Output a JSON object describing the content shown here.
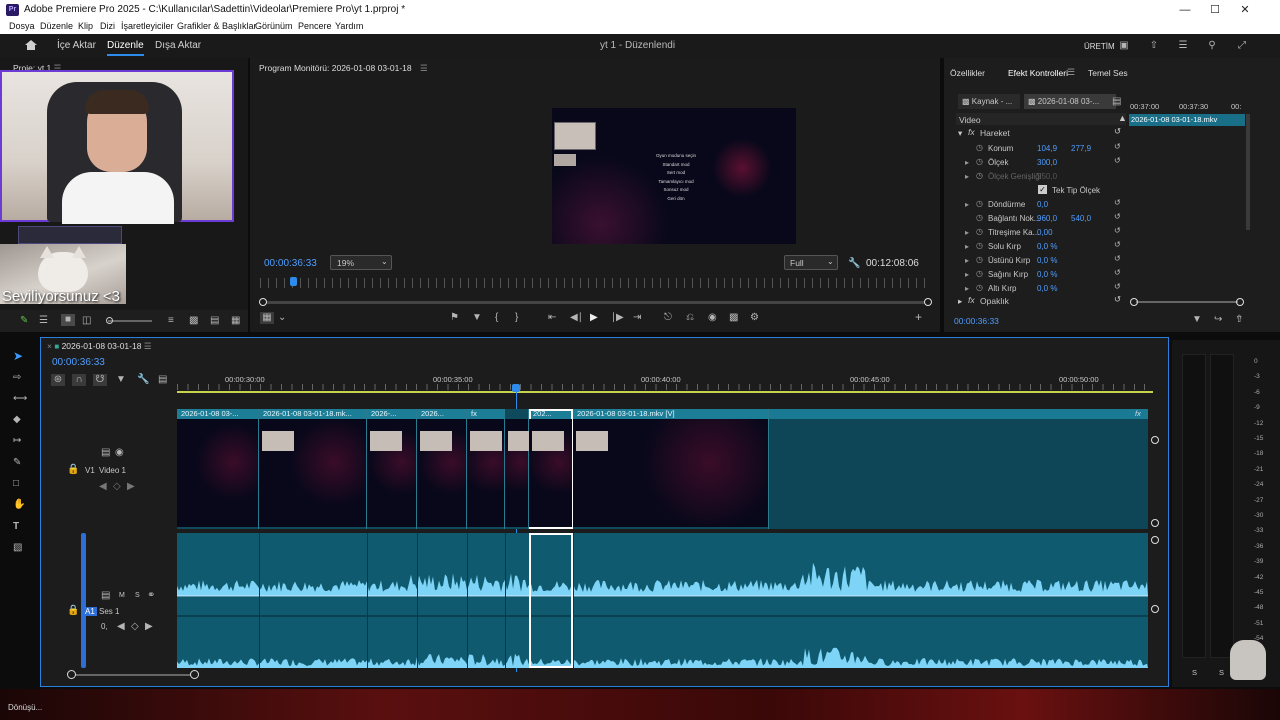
{
  "window": {
    "title": "Adobe Premiere Pro 2025 - C:\\Kullanıcılar\\Sadettin\\Videolar\\Premiere Pro\\yt 1.prproj *",
    "logo": "Pr"
  },
  "menu": [
    "Dosya",
    "Düzenle",
    "Klip",
    "Dizi",
    "İşaretleyiciler",
    "Grafikler & Başlıklar",
    "Görünüm",
    "Pencere",
    "Yardım"
  ],
  "nav": {
    "home_icon": "home-icon",
    "import": "İçe Aktar",
    "edit": "Düzenle",
    "export": "Dışa Aktar",
    "center_title": "yt 1 - Düzenlendi",
    "workspace": "ÜRETİM"
  },
  "project": {
    "title": "Proje: yt 1",
    "webcam_caption": "Seviliyorsunuz <3"
  },
  "program_monitor": {
    "title": "Program Monitörü: 2026-01-08 03-01-18",
    "timecode": "00:00:36:33",
    "zoom": "19%",
    "quality": "Full",
    "duration": "00:12:08:06",
    "preview_menu": [
      "Oyun modunu seçin",
      "Standart mod",
      "Sert mod",
      "Tamamlayıcı mod",
      "Sonsuz mod",
      "Geri dön"
    ]
  },
  "effect_panel": {
    "tabs": [
      "Özellikler",
      "Efekt Kontrolleri",
      "Temel Ses"
    ],
    "source_label": "Kaynak - ...",
    "clip_label": "2026-01-08 03-...",
    "mini_times": [
      "00:37:00",
      "00:37:30",
      "00:"
    ],
    "mini_clip": "2026-01-08 03-01-18.mkv",
    "section_video": "Video",
    "fx_motion": "Hareket",
    "props": [
      {
        "name": "Konum",
        "v1": "104,9",
        "v2": "277,9"
      },
      {
        "name": "Ölçek",
        "v1": "300,0",
        "v2": ""
      },
      {
        "name": "Ölçek Genişliği",
        "v1": "250,0",
        "v2": ""
      },
      {
        "name": "Tek Tip Ölçek",
        "v1": "",
        "v2": ""
      },
      {
        "name": "Döndürme",
        "v1": "0,0",
        "v2": ""
      },
      {
        "name": "Bağlantı Nok...",
        "v1": "960,0",
        "v2": "540,0"
      },
      {
        "name": "Titreşime Ka...",
        "v1": "0,00",
        "v2": ""
      },
      {
        "name": "Solu Kırp",
        "v1": "0,0 %",
        "v2": ""
      },
      {
        "name": "Üstünü Kırp",
        "v1": "0,0 %",
        "v2": ""
      },
      {
        "name": "Sağını Kırp",
        "v1": "0,0 %",
        "v2": ""
      },
      {
        "name": "Altı Kırp",
        "v1": "0,0 %",
        "v2": ""
      }
    ],
    "fx_opacity": "Opaklık",
    "timecode": "00:00:36:33"
  },
  "timeline": {
    "sequence_name": "2026-01-08 03-01-18",
    "timecode": "00:00:36:33",
    "ruler": [
      "00:00:30:00",
      "00:00:35:00",
      "00:00:40:00",
      "00:00:45:00",
      "00:00:50:00"
    ],
    "v1_label": "V1",
    "v1_name": "Video 1",
    "a1_label": "A1",
    "a1_name": "Ses 1",
    "a1_volume": "0,",
    "track_letters": [
      "M",
      "S"
    ],
    "fx_marker": "fx",
    "clips": [
      {
        "label": "2026-01-08 03-..."
      },
      {
        "label": "2026-01-08 03-01-18.mk..."
      },
      {
        "label": "2026-..."
      },
      {
        "label": "2026..."
      },
      {
        "label": "fx"
      },
      {
        "label": ""
      },
      {
        "label": "202..."
      },
      {
        "label": "2026-01-08 03-01-18.mkv [V]"
      }
    ]
  },
  "meter": {
    "scale": [
      "0",
      "-3",
      "-6",
      "-9",
      "-12",
      "-15",
      "-18",
      "-21",
      "-24",
      "-27",
      "-30",
      "-33",
      "-36",
      "-39",
      "-42",
      "-45",
      "-48",
      "-51",
      "-54"
    ],
    "bottom": [
      "S",
      "S"
    ]
  },
  "status": "Dönüşü..."
}
